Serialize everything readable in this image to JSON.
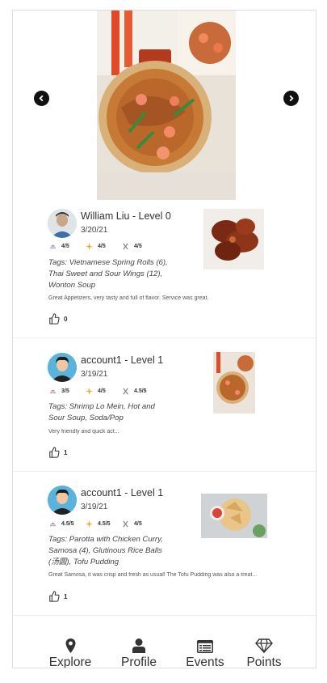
{
  "carousel": {
    "prev_icon": "chevron-left-circle-icon",
    "next_icon": "chevron-right-circle-icon"
  },
  "reviews": [
    {
      "author": "William Liu - Level 0",
      "date": "3/20/21",
      "ratings": [
        "4/5",
        "4/5",
        "4/5"
      ],
      "tags": "Tags: Vietnamese Spring Rolls (6), Thai Sweet and Sour Wings (12), Wonton Soup",
      "comment": "Great Appetizers, very tasty and full of flavor. Service was great.",
      "likes": "0"
    },
    {
      "author": "account1 - Level 1",
      "date": "3/19/21",
      "ratings": [
        "3/5",
        "4/5",
        "4.5/5"
      ],
      "tags": "Tags: Shrimp Lo Mein, Hot and Sour Soup, Soda/Pop",
      "comment": "Very friendly and quick act...",
      "likes": "1"
    },
    {
      "author": "account1 - Level 1",
      "date": "3/19/21",
      "ratings": [
        "4.5/5",
        "4.5/5",
        "4/5"
      ],
      "tags": "Tags: Parotta with Chicken Curry, Samosa (4), Glutinous Rice Balls (汤圆), Tofu Pudding",
      "comment": "Great Samosa, it was crisp and fresh as usual! The Tofu Pudding was also a treat...",
      "likes": "1"
    }
  ],
  "nav": {
    "items": [
      {
        "label": "Explore",
        "icon": "map-pin-icon"
      },
      {
        "label": "Profile",
        "icon": "user-icon"
      },
      {
        "label": "Events",
        "icon": "list-icon"
      },
      {
        "label": "Points",
        "icon": "diamond-icon"
      }
    ]
  }
}
